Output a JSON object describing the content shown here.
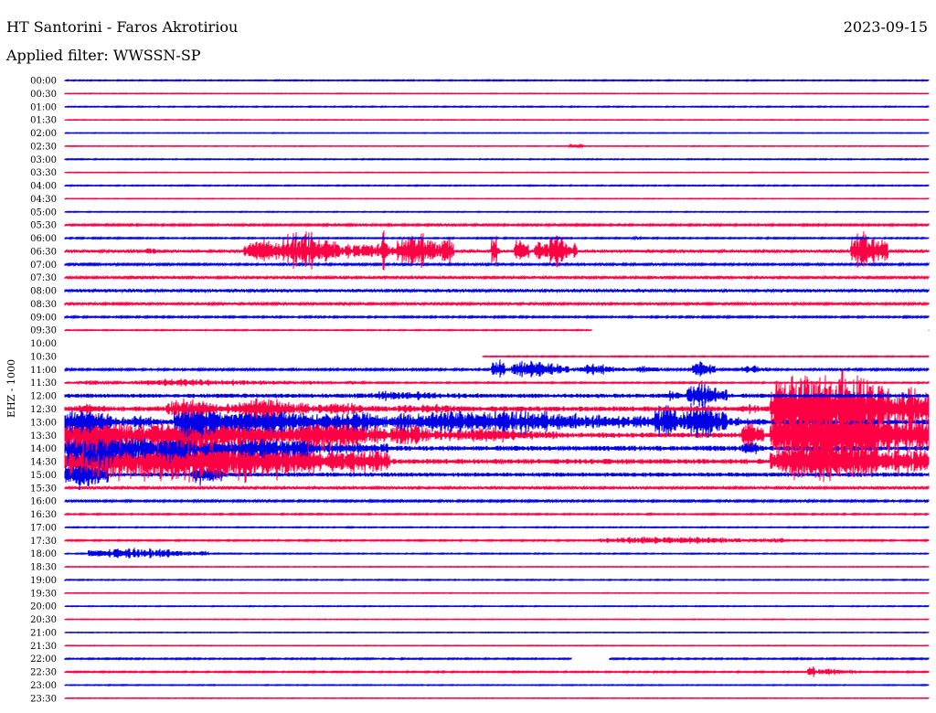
{
  "header": {
    "station": "HT Santorini - Faros Akrotiriou",
    "date": "2023-09-15",
    "filter": "Applied filter: WWSSN-SP"
  },
  "chart_data": {
    "type": "line",
    "channel_label": "EHZ - 1000",
    "colors": {
      "odd_rows": "#0000e6",
      "even_rows": "#ff0044"
    },
    "rows": [
      "00:00",
      "00:30",
      "01:00",
      "01:30",
      "02:00",
      "02:30",
      "03:00",
      "03:30",
      "04:00",
      "04:30",
      "05:00",
      "05:30",
      "06:00",
      "06:30",
      "07:00",
      "07:30",
      "08:00",
      "08:30",
      "09:00",
      "09:30",
      "10:00",
      "10:30",
      "11:00",
      "11:30",
      "12:00",
      "12:30",
      "13:00",
      "13:30",
      "14:00",
      "14:30",
      "15:00",
      "15:30",
      "16:00",
      "16:30",
      "17:00",
      "17:30",
      "18:00",
      "18:30",
      "19:00",
      "19:30",
      "20:00",
      "20:30",
      "21:00",
      "21:30",
      "22:00",
      "22:30",
      "23:00",
      "23:30"
    ],
    "row_minutes": 30,
    "noise": [
      0.6,
      0.4,
      0.6,
      0.4,
      0.4,
      0.4,
      0.6,
      0.4,
      0.6,
      0.4,
      0.5,
      1.2,
      0.8,
      1.6,
      1.2,
      1.5,
      1.8,
      1.4,
      1.0,
      0.6,
      0,
      0.6,
      1.2,
      0.8,
      2.5,
      3,
      3,
      3,
      3,
      3,
      2.5,
      1.5,
      1.2,
      0.8,
      0.6,
      0.8,
      0.6,
      0.4,
      0.6,
      0.4,
      0.5,
      0.4,
      0.4,
      0.4,
      0.8,
      0.8,
      0.5,
      0.4
    ],
    "missing": [
      {
        "row": 19,
        "from_min": 18.3,
        "to_min": 30
      },
      {
        "row": 20,
        "from_min": 0,
        "to_min": 30
      },
      {
        "row": 21,
        "from_min": 0,
        "to_min": 14.5
      },
      {
        "row": 44,
        "from_min": 17.6,
        "to_min": 18.9
      }
    ],
    "bursts": [
      {
        "row": 5,
        "from_min": 17.5,
        "to_min": 18,
        "amp": 3
      },
      {
        "row": 13,
        "from_min": 2.8,
        "to_min": 3.3,
        "amp": 5
      },
      {
        "row": 13,
        "from_min": 6.2,
        "to_min": 8,
        "amp": 16
      },
      {
        "row": 13,
        "from_min": 7.5,
        "to_min": 9.5,
        "amp": 26
      },
      {
        "row": 13,
        "from_min": 9.3,
        "to_min": 12.8,
        "amp": 10
      },
      {
        "row": 13,
        "from_min": 11,
        "to_min": 11.2,
        "amp": 30
      },
      {
        "row": 13,
        "from_min": 11.5,
        "to_min": 13.5,
        "amp": 22
      },
      {
        "row": 13,
        "from_min": 13.1,
        "to_min": 13.5,
        "amp": 24
      },
      {
        "row": 13,
        "from_min": 14.8,
        "to_min": 15.1,
        "amp": 24
      },
      {
        "row": 13,
        "from_min": 15.6,
        "to_min": 16.1,
        "amp": 18
      },
      {
        "row": 13,
        "from_min": 16.3,
        "to_min": 16.8,
        "amp": 16
      },
      {
        "row": 13,
        "from_min": 16.6,
        "to_min": 17.8,
        "amp": 20
      },
      {
        "row": 13,
        "from_min": 27.3,
        "to_min": 28.6,
        "amp": 26
      },
      {
        "row": 12,
        "from_min": 19.7,
        "to_min": 20,
        "amp": 3
      },
      {
        "row": 22,
        "from_min": 14.8,
        "to_min": 15.3,
        "amp": 15
      },
      {
        "row": 22,
        "from_min": 15.5,
        "to_min": 17.5,
        "amp": 12
      },
      {
        "row": 22,
        "from_min": 17.8,
        "to_min": 19.5,
        "amp": 7
      },
      {
        "row": 22,
        "from_min": 19.8,
        "to_min": 20.8,
        "amp": 5
      },
      {
        "row": 22,
        "from_min": 21.8,
        "to_min": 22.6,
        "amp": 12
      },
      {
        "row": 22,
        "from_min": 23.5,
        "to_min": 24.4,
        "amp": 6
      },
      {
        "row": 22,
        "from_min": 28.5,
        "to_min": 29.5,
        "amp": 3
      },
      {
        "row": 23,
        "from_min": 0.4,
        "to_min": 2.1,
        "amp": 3
      },
      {
        "row": 23,
        "from_min": 2.3,
        "to_min": 8,
        "amp": 5
      },
      {
        "row": 23,
        "from_min": 8.2,
        "to_min": 9.3,
        "amp": 3
      },
      {
        "row": 23,
        "from_min": 9.8,
        "to_min": 10.7,
        "amp": 2
      },
      {
        "row": 24,
        "from_min": 10,
        "to_min": 14.5,
        "amp": 6
      },
      {
        "row": 24,
        "from_min": 20.8,
        "to_min": 21.5,
        "amp": 7
      },
      {
        "row": 24,
        "from_min": 21.6,
        "to_min": 23,
        "amp": 18
      },
      {
        "row": 25,
        "from_min": 0,
        "to_min": 2.1,
        "amp": 6
      },
      {
        "row": 25,
        "from_min": 3.5,
        "to_min": 5.7,
        "amp": 12
      },
      {
        "row": 25,
        "from_min": 5.8,
        "to_min": 8.5,
        "amp": 14
      },
      {
        "row": 25,
        "from_min": 8.6,
        "to_min": 11.2,
        "amp": 8
      },
      {
        "row": 25,
        "from_min": 11.3,
        "to_min": 15,
        "amp": 6
      },
      {
        "row": 25,
        "from_min": 23.5,
        "to_min": 24.3,
        "amp": 6
      },
      {
        "row": 25,
        "from_min": 24.5,
        "to_min": 30,
        "amp": 50
      },
      {
        "row": 26,
        "from_min": 0,
        "to_min": 1.8,
        "amp": 18
      },
      {
        "row": 26,
        "from_min": 1.8,
        "to_min": 3.8,
        "amp": 8
      },
      {
        "row": 26,
        "from_min": 3.8,
        "to_min": 5.8,
        "amp": 26
      },
      {
        "row": 26,
        "from_min": 5.8,
        "to_min": 9.4,
        "amp": 20
      },
      {
        "row": 26,
        "from_min": 9.4,
        "to_min": 11.3,
        "amp": 16
      },
      {
        "row": 26,
        "from_min": 11.3,
        "to_min": 20.4,
        "amp": 16
      },
      {
        "row": 26,
        "from_min": 20.4,
        "to_min": 21.6,
        "amp": 22
      },
      {
        "row": 26,
        "from_min": 21.6,
        "to_min": 23,
        "amp": 30
      },
      {
        "row": 26,
        "from_min": 23,
        "to_min": 23.6,
        "amp": 8
      },
      {
        "row": 26,
        "from_min": 23.6,
        "to_min": 24.5,
        "amp": 6
      },
      {
        "row": 27,
        "from_min": 0,
        "to_min": 2.8,
        "amp": 28
      },
      {
        "row": 27,
        "from_min": 2.8,
        "to_min": 8,
        "amp": 24
      },
      {
        "row": 27,
        "from_min": 8,
        "to_min": 11.2,
        "amp": 22
      },
      {
        "row": 27,
        "from_min": 11.3,
        "to_min": 13.1,
        "amp": 16
      },
      {
        "row": 27,
        "from_min": 13.1,
        "to_min": 17.1,
        "amp": 10
      },
      {
        "row": 27,
        "from_min": 23.5,
        "to_min": 24.3,
        "amp": 22
      },
      {
        "row": 27,
        "from_min": 24.5,
        "to_min": 30,
        "amp": 50
      },
      {
        "row": 28,
        "from_min": 0,
        "to_min": 2.8,
        "amp": 30
      },
      {
        "row": 28,
        "from_min": 2.8,
        "to_min": 5,
        "amp": 22
      },
      {
        "row": 28,
        "from_min": 5,
        "to_min": 10.5,
        "amp": 14
      },
      {
        "row": 28,
        "from_min": 10.5,
        "to_min": 11.5,
        "amp": 8
      },
      {
        "row": 28,
        "from_min": 23.5,
        "to_min": 24.3,
        "amp": 10
      },
      {
        "row": 29,
        "from_min": 0,
        "to_min": 11.3,
        "amp": 30
      },
      {
        "row": 29,
        "from_min": 24.5,
        "to_min": 30,
        "amp": 30
      },
      {
        "row": 30,
        "from_min": 0,
        "to_min": 1.5,
        "amp": 22
      },
      {
        "row": 30,
        "from_min": 4.4,
        "to_min": 5.6,
        "amp": 14
      },
      {
        "row": 35,
        "from_min": 18.5,
        "to_min": 25,
        "amp": 5
      },
      {
        "row": 36,
        "from_min": 0.8,
        "to_min": 5,
        "amp": 7
      },
      {
        "row": 45,
        "from_min": 25.8,
        "to_min": 26.1,
        "amp": 12
      },
      {
        "row": 45,
        "from_min": 26.1,
        "to_min": 27.5,
        "amp": 5
      }
    ]
  }
}
